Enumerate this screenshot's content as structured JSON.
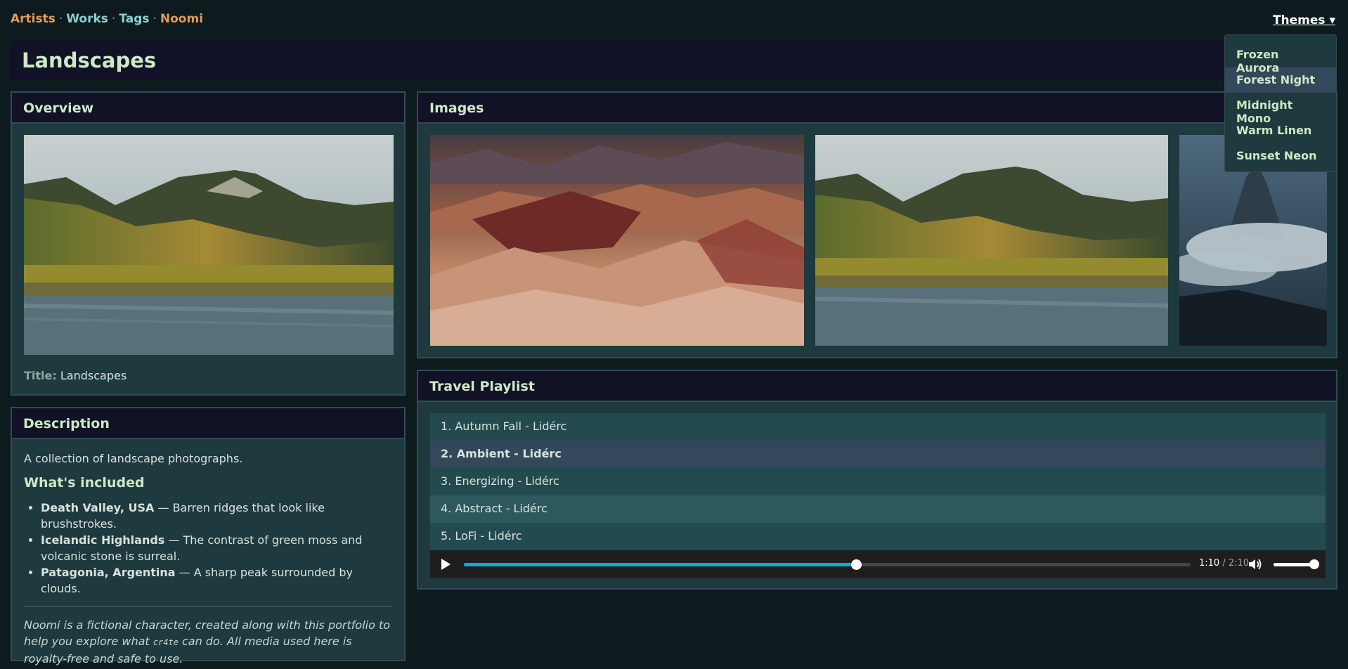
{
  "nav": {
    "artists": "Artists",
    "works": "Works",
    "tags": "Tags",
    "noomi": "Noomi",
    "separator": "·",
    "themes": "Themes ▾"
  },
  "page": {
    "title": "Landscapes"
  },
  "overview": {
    "heading": "Overview",
    "title_label": "Title:",
    "title_value": "Landscapes"
  },
  "description": {
    "heading": "Description",
    "intro": "A collection of landscape photographs.",
    "included_heading": "What's included",
    "items": [
      {
        "name": "Death Valley, USA",
        "text": " — Barren ridges that look like brushstrokes."
      },
      {
        "name": "Icelandic Highlands",
        "text": " — The contrast of green moss and volcanic stone is surreal."
      },
      {
        "name": "Patagonia, Argentina",
        "text": " — A sharp peak surrounded by clouds."
      }
    ],
    "note_part1": "Noomi is a fictional character, created along with this portfolio to help you explore what ",
    "note_code": "cr4te",
    "note_part2": " can do. All media used here is royalty-free and safe to use."
  },
  "images": {
    "heading": "Images"
  },
  "playlist": {
    "heading": "Travel Playlist",
    "tracks": [
      "1. Autumn Fall - Lidérc",
      "2. Ambient - Lidérc",
      "3. Energizing - Lidérc",
      "4. Abstract - Lidérc",
      "5. LoFi - Lidérc"
    ],
    "current_time": "1:10",
    "time_sep": " / ",
    "duration": "2:10",
    "progress": 0.54,
    "volume": 1.0,
    "accent_color": "#1aa3e0"
  },
  "themes": {
    "options": [
      "Frozen Aurora",
      "Forest Night",
      "Midnight Mono",
      "Warm Linen",
      "Sunset Neon"
    ],
    "selected": "Forest Night"
  }
}
